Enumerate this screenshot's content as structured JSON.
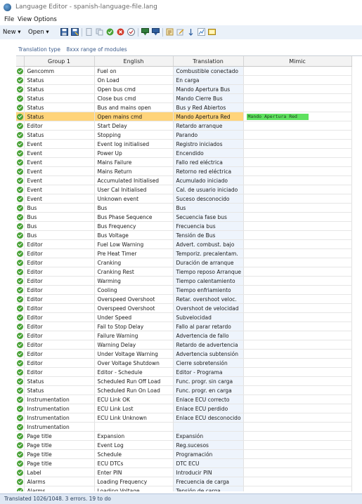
{
  "window": {
    "title": "Language Editor - spanish-language-file.lang"
  },
  "menu": [
    "File",
    "View",
    "Options"
  ],
  "toolbar": {
    "new_label": "New",
    "open_label": "Open"
  },
  "subtitle": {
    "translation_type_label": "Translation type",
    "range_label": "8xxx range of modules"
  },
  "columns": [
    "Group 1",
    "English",
    "Translation",
    "Mimic"
  ],
  "rows": [
    {
      "group": "Gencomm",
      "english": "Fuel on",
      "translation": "Combustible conectado",
      "mimic": ""
    },
    {
      "group": "Status",
      "english": "On Load",
      "translation": "En carga",
      "mimic": ""
    },
    {
      "group": "Status",
      "english": "Open bus cmd",
      "translation": "Mando Apertura Bus",
      "mimic": ""
    },
    {
      "group": "Status",
      "english": "Close bus cmd",
      "translation": "Mando Cierre Bus",
      "mimic": ""
    },
    {
      "group": "Status",
      "english": "Bus and mains open",
      "translation": "Bus y Red Abiertos",
      "mimic": ""
    },
    {
      "group": "Status",
      "english": "Open mains cmd",
      "translation": "Mando Apertura Red",
      "mimic": "Mando Apertura Red",
      "selected": true
    },
    {
      "group": "Editor",
      "english": "Start Delay",
      "translation": "Retardo arranque",
      "mimic": ""
    },
    {
      "group": "Status",
      "english": "Stopping",
      "translation": "Parando",
      "mimic": ""
    },
    {
      "group": "Event",
      "english": "Event log initialised",
      "translation": "Registro iniciados",
      "mimic": ""
    },
    {
      "group": "Event",
      "english": "Power Up",
      "translation": "Encendido",
      "mimic": ""
    },
    {
      "group": "Event",
      "english": "Mains Failure",
      "translation": "Fallo red eléctrica",
      "mimic": ""
    },
    {
      "group": "Event",
      "english": "Mains Return",
      "translation": "Retorno red eléctrica",
      "mimic": ""
    },
    {
      "group": "Event",
      "english": "Accumulated Initialised",
      "translation": "Acumulado iniciado",
      "mimic": ""
    },
    {
      "group": "Event",
      "english": "User Cal Initialised",
      "translation": "Cal. de usuario iniciado",
      "mimic": ""
    },
    {
      "group": "Event",
      "english": "Unknown event",
      "translation": "Suceso desconocido",
      "mimic": ""
    },
    {
      "group": "Bus",
      "english": "Bus",
      "translation": "Bus",
      "mimic": ""
    },
    {
      "group": "Bus",
      "english": "Bus Phase Sequence",
      "translation": "Secuencia fase bus",
      "mimic": ""
    },
    {
      "group": "Bus",
      "english": "Bus Frequency",
      "translation": "Frecuencia bus",
      "mimic": ""
    },
    {
      "group": "Bus",
      "english": "Bus Voltage",
      "translation": "Tensión de Bus",
      "mimic": ""
    },
    {
      "group": "Editor",
      "english": "Fuel Low Warning",
      "translation": "Advert. combust. bajo",
      "mimic": ""
    },
    {
      "group": "Editor",
      "english": "Pre Heat Timer",
      "translation": "Temporiz. precalentam.",
      "mimic": ""
    },
    {
      "group": "Editor",
      "english": "Cranking",
      "translation": "Duración de arranque",
      "mimic": ""
    },
    {
      "group": "Editor",
      "english": "Cranking Rest",
      "translation": "Tiempo reposo Arranque",
      "mimic": ""
    },
    {
      "group": "Editor",
      "english": "Warming",
      "translation": "Tiempo calentamiento",
      "mimic": ""
    },
    {
      "group": "Editor",
      "english": "Cooling",
      "translation": "Tiempo enfriamiento",
      "mimic": ""
    },
    {
      "group": "Editor",
      "english": "Overspeed Overshoot",
      "translation": "Retar. overshoot veloc.",
      "mimic": ""
    },
    {
      "group": "Editor",
      "english": "Overspeed Overshoot",
      "translation": "Overshoot de velocidad",
      "mimic": ""
    },
    {
      "group": "Editor",
      "english": "Under Speed",
      "translation": "Subvelocidad",
      "mimic": ""
    },
    {
      "group": "Editor",
      "english": "Fail to Stop Delay",
      "translation": "Fallo al parar retardo",
      "mimic": ""
    },
    {
      "group": "Editor",
      "english": "Failure Warning",
      "translation": "Advertencia de fallo",
      "mimic": ""
    },
    {
      "group": "Editor",
      "english": "Warning Delay",
      "translation": "Retardo de advertencia",
      "mimic": ""
    },
    {
      "group": "Editor",
      "english": "Under Voltage Warning",
      "translation": "Advertencia subtensión",
      "mimic": ""
    },
    {
      "group": "Editor",
      "english": "Over Voltage Shutdown",
      "translation": "Cierre sobretensión",
      "mimic": ""
    },
    {
      "group": "Editor",
      "english": "Editor - Schedule",
      "translation": "Editor - Programa",
      "mimic": ""
    },
    {
      "group": "Status",
      "english": "Scheduled Run Off Load",
      "translation": "Func. progr. sin carga",
      "mimic": ""
    },
    {
      "group": "Status",
      "english": "Scheduled Run On Load",
      "translation": "Func. progr. en carga",
      "mimic": ""
    },
    {
      "group": "Instrumentation",
      "english": "ECU Link OK",
      "translation": "Enlace ECU correcto",
      "mimic": ""
    },
    {
      "group": "Instrumentation",
      "english": "ECU Link Lost",
      "translation": "Enlace ECU perdido",
      "mimic": ""
    },
    {
      "group": "Instrumentation",
      "english": "ECU Link Unknown",
      "translation": "Enlace ECU desconocido",
      "mimic": ""
    },
    {
      "group": "Instrumentation",
      "english": "",
      "translation": "",
      "mimic": ""
    },
    {
      "group": "Page title",
      "english": "Expansion",
      "translation": "Expansión",
      "mimic": ""
    },
    {
      "group": "Page title",
      "english": "Event Log",
      "translation": "Reg.sucesos",
      "mimic": ""
    },
    {
      "group": "Page title",
      "english": "Schedule",
      "translation": "Programación",
      "mimic": ""
    },
    {
      "group": "Page title",
      "english": "ECU DTCs",
      "translation": "DTC ECU",
      "mimic": ""
    },
    {
      "group": "Label",
      "english": "Enter PIN",
      "translation": "Introducir PIN",
      "mimic": ""
    },
    {
      "group": "Alarms",
      "english": "Loading Frequency",
      "translation": "Frecuencia de carga",
      "mimic": ""
    },
    {
      "group": "Alarms",
      "english": "Loading Voltage",
      "translation": "Tensión de carga",
      "mimic": ""
    }
  ],
  "status": {
    "text": "Translated 1026/1048. 3 errors. 19 to do"
  },
  "colors": {
    "ok": "#4aa238",
    "selected_row": "#ffd47a",
    "mimic_highlight": "#5fe15f",
    "toolbar_bg": "#eaf1f9"
  }
}
